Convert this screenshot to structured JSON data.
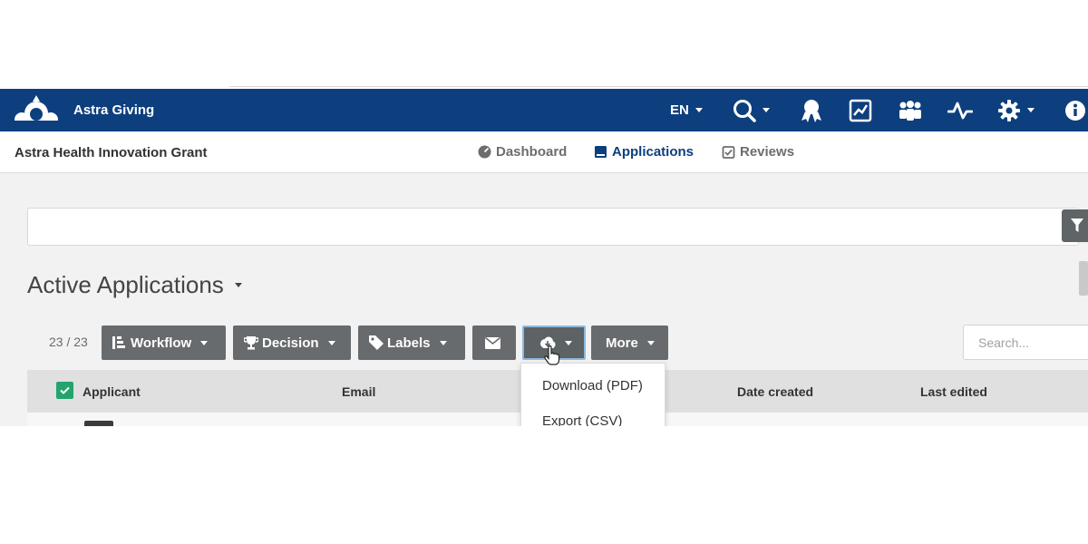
{
  "topbar": {
    "brand": "Astra Giving",
    "language": "EN"
  },
  "subnav": {
    "program_title": "Astra Health Innovation Grant",
    "tabs": [
      {
        "label": "Dashboard",
        "icon": "dashboard-icon"
      },
      {
        "label": "Applications",
        "icon": "applications-icon",
        "active": true
      },
      {
        "label": "Reviews",
        "icon": "reviews-icon"
      }
    ]
  },
  "main": {
    "section_title": "Active Applications",
    "count": "23 / 23",
    "toolbar": {
      "workflow": "Workflow",
      "decision": "Decision",
      "labels": "Labels",
      "more": "More"
    },
    "search_placeholder": "Search...",
    "columns": {
      "applicant": "Applicant",
      "email": "Email",
      "date_created": "Date created",
      "last_edited": "Last edited"
    },
    "download_menu": {
      "items": [
        "Download (PDF)",
        "Export (CSV)"
      ]
    }
  },
  "colors": {
    "brand_blue": "#0d3f7e",
    "button_gray": "#676b6d",
    "check_green": "#23a46d"
  }
}
